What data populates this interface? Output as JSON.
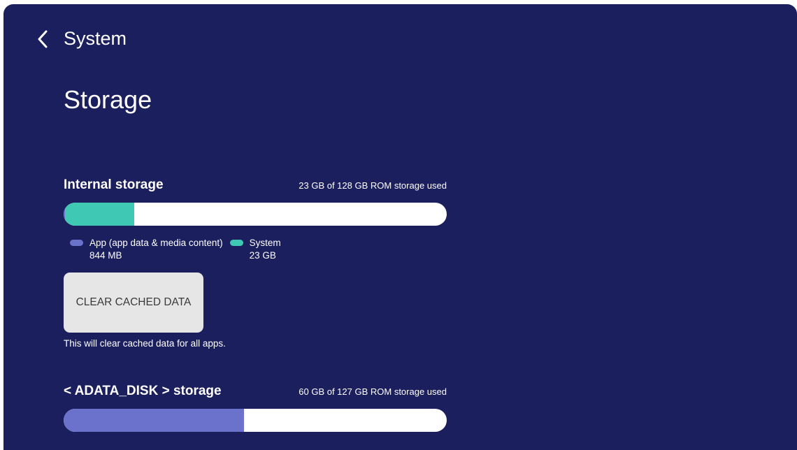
{
  "header": {
    "back_label": "System",
    "back_icon": "chevron-left-icon"
  },
  "page": {
    "title": "Storage"
  },
  "internal_storage": {
    "title": "Internal storage",
    "usage_text": "23 GB of 128 GB ROM storage used",
    "segments": [
      {
        "name": "app",
        "fraction": 0.004,
        "color": "#6b72cc"
      },
      {
        "name": "system",
        "fraction": 0.18,
        "color": "#3fc9b5"
      }
    ],
    "legend": [
      {
        "label": "App (app data & media content)",
        "size": "844 MB",
        "color": "#6b72cc"
      },
      {
        "label": "System",
        "size": "23 GB",
        "color": "#3fc9b5"
      }
    ],
    "clear_button_label": "CLEAR CACHED DATA",
    "clear_description": "This will clear cached data for all apps."
  },
  "external_storage": {
    "title": "< ADATA_DISK > storage",
    "usage_text": "60 GB of 127 GB ROM storage used",
    "segments": [
      {
        "name": "used",
        "fraction": 0.47,
        "color": "#6b72cc"
      }
    ]
  },
  "colors": {
    "background": "#1b1f5e",
    "bar_empty": "#ffffff",
    "app": "#6b72cc",
    "system": "#3fc9b5",
    "button_bg": "#e6e6e6"
  }
}
